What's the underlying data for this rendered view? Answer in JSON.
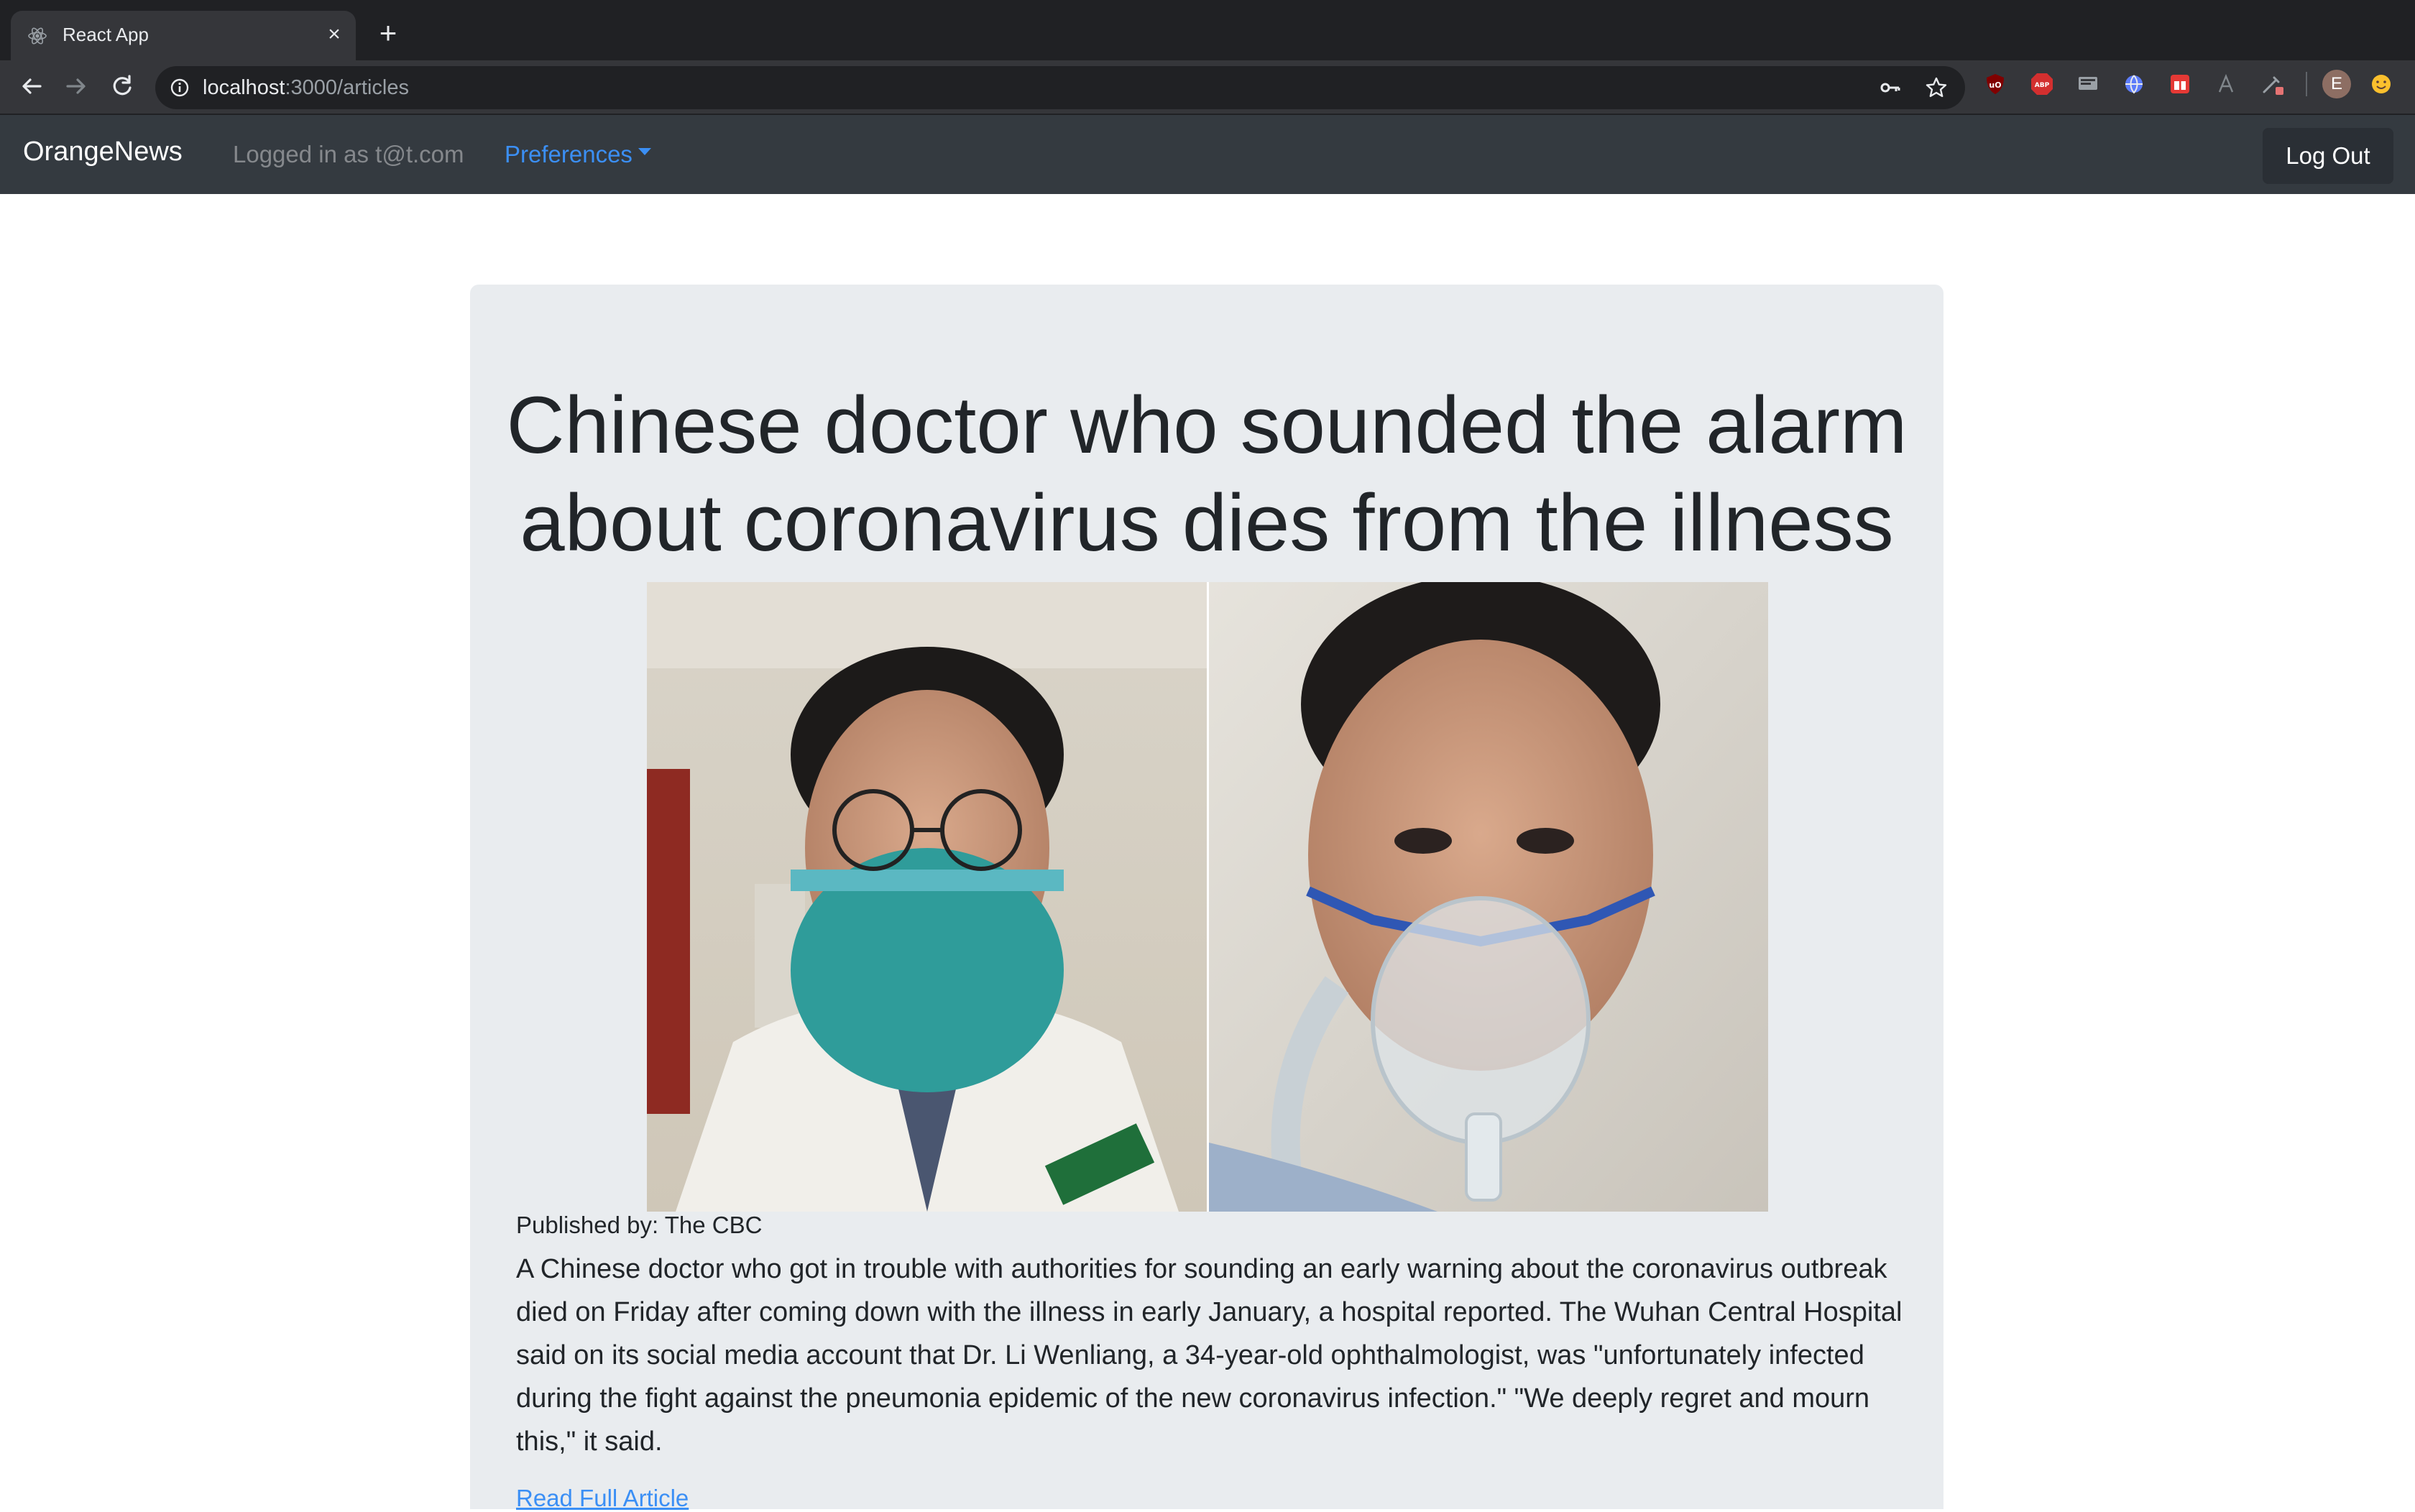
{
  "browser": {
    "tab_title": "React App",
    "tab_close": "×",
    "new_tab": "+",
    "url_host": "localhost",
    "url_path": ":3000/articles",
    "profile_initial": "E"
  },
  "navbar": {
    "brand": "OrangeNews",
    "logged_in": "Logged in as t@t.com",
    "preferences": "Preferences",
    "logout": "Log Out"
  },
  "article": {
    "title": "Chinese doctor who sounded the alarm about coronavirus dies from the illness",
    "image_alt": "Two photos of a doctor: one wearing a green face mask, one in a hospital bed with an oxygen mask",
    "publisher": "Published by: The CBC",
    "summary": "A Chinese doctor who got in trouble with authorities for sounding an early warning about the coronavirus outbreak died on Friday after coming down with the illness in early January, a hospital reported. The Wuhan Central Hospital said on its social media account that Dr. Li Wenliang, a 34-year-old ophthalmologist, was \"unfortunately infected during the fight against the pneumonia epidemic of the new coronavirus infection.\" \"We deeply regret and mourn this,\" it said.",
    "read_more": "Read Full Article"
  },
  "colors": {
    "navbar_bg": "#343a40",
    "card_bg": "#e9ecef",
    "link": "#3b8ff5"
  }
}
